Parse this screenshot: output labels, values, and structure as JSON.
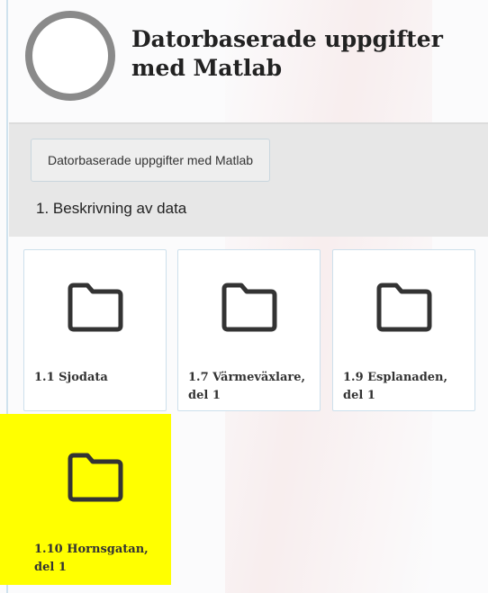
{
  "header": {
    "title": "Datorbaserade uppgifter med Matlab"
  },
  "breadcrumb": {
    "course_button": "Datorbaserade uppgifter med Matlab"
  },
  "section": {
    "title": "1. Beskrivning av data"
  },
  "folders": [
    {
      "label": "1.1 Sjodata"
    },
    {
      "label": "1.7 Värmeväxlare, del 1"
    },
    {
      "label": "1.9 Esplanaden, del 1"
    },
    {
      "label": "1.10 Hornsgatan, del 1"
    }
  ],
  "colors": {
    "highlight": "#ffff00",
    "logo_ring": "#8a8a8a",
    "breadcrumb_bg": "#e7e7e7",
    "tile_border": "#cde0ec",
    "folder_icon": "#333333"
  },
  "icons": {
    "folder": "folder-icon",
    "logo": "logo-circle"
  }
}
